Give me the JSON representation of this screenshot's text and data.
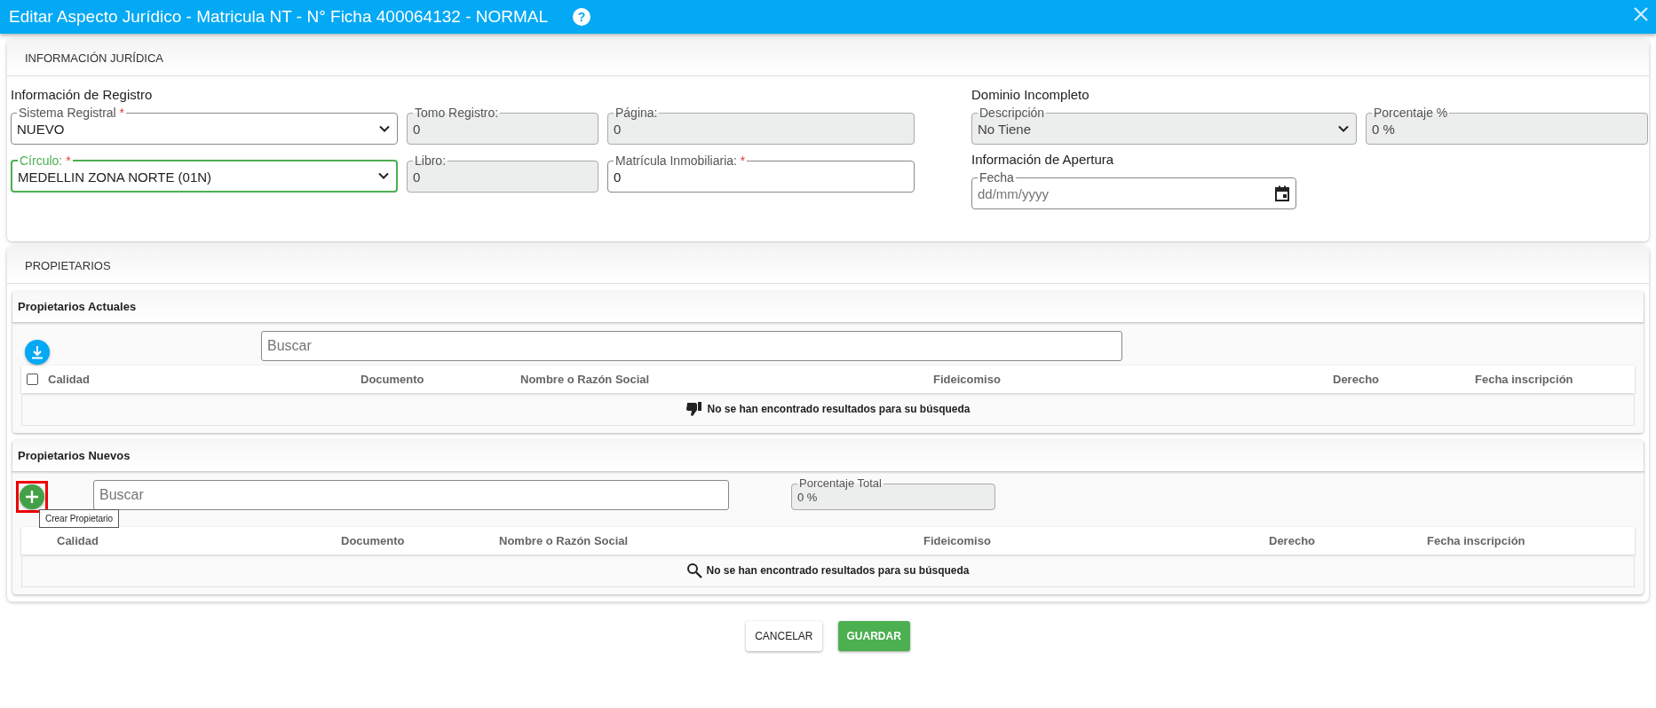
{
  "window": {
    "title": "Editar Aspecto Jurídico - Matricula NT - N° Ficha 400064132 - NORMAL",
    "help": "?"
  },
  "informacion_juridica": {
    "title": "INFORMACIÓN JURÍDICA",
    "registro": {
      "heading": "Información de Registro",
      "fields": [
        {
          "label": "Sistema Registral",
          "required_mark": "*",
          "kind": "select",
          "value": "NUEVO",
          "disabled": false,
          "focused": false
        },
        {
          "label": "Tomo Registro:",
          "kind": "text",
          "value": "0",
          "disabled": true,
          "focused": false
        },
        {
          "label": "Página:",
          "kind": "text",
          "value": "0",
          "disabled": true,
          "focused": false
        },
        {
          "label": "Círculo:",
          "required_mark": "*",
          "kind": "select",
          "value": "MEDELLIN ZONA NORTE (01N)",
          "disabled": false,
          "focused": true
        },
        {
          "label": "Libro:",
          "kind": "text",
          "value": "0",
          "disabled": true,
          "focused": false
        },
        {
          "label": "Matrícula Inmobiliaria:",
          "required_mark": "*",
          "kind": "text",
          "value": "0",
          "disabled": false,
          "focused": false
        }
      ]
    },
    "dominio": {
      "heading": "Dominio Incompleto",
      "fields": [
        {
          "label": "Descripción",
          "kind": "select",
          "value": "No Tiene",
          "disabled": true,
          "focused": false
        },
        {
          "label": "Porcentaje %",
          "kind": "text",
          "value": "0 %",
          "disabled": true,
          "focused": false
        }
      ]
    },
    "apertura": {
      "heading": "Información de Apertura",
      "fields": [
        {
          "label": "Fecha",
          "kind": "date",
          "placeholder": "dd/mm/yyyy",
          "disabled": false,
          "focused": false
        }
      ]
    }
  },
  "propietarios": {
    "title": "PROPIETARIOS",
    "actuales": {
      "title": "Propietarios Actuales",
      "search": {
        "placeholder": "Buscar"
      },
      "select_all": {
        "checked": false
      },
      "columns": [
        "Calidad",
        "Documento",
        "Nombre o Razón Social",
        "Fideicomiso",
        "Derecho",
        "Fecha inscripción"
      ],
      "empty_message": "No se han encontrado resultados para su búsqueda"
    },
    "nuevos": {
      "title": "Propietarios Nuevos",
      "search": {
        "placeholder": "Buscar"
      },
      "porcentaje_total": {
        "label": "Porcentaje Total",
        "value": "0 %"
      },
      "tooltip": "Crear Propietario",
      "columns": [
        "Calidad",
        "Documento",
        "Nombre o Razón Social",
        "Fideicomiso",
        "Derecho",
        "Fecha inscripción"
      ],
      "empty_message": "No se han encontrado resultados para su búsqueda"
    }
  },
  "buttons": [
    {
      "label": "CANCELAR",
      "kind": "secondary"
    },
    {
      "label": "GUARDAR",
      "kind": "primary"
    }
  ]
}
